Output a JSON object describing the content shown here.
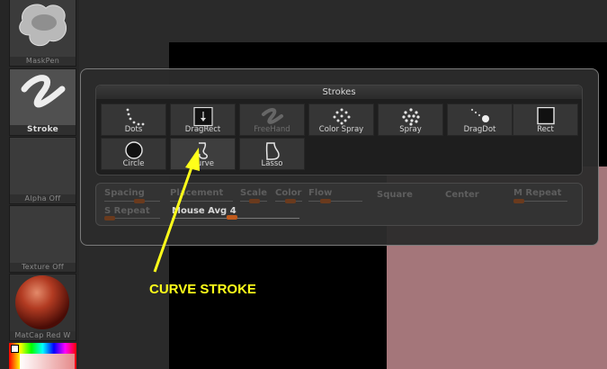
{
  "shelf": {
    "brush_label": "MaskPen",
    "stroke_label": "Stroke",
    "alpha_label": "Alpha Off",
    "texture_label": "Texture Off",
    "material_label": "MatCap Red W"
  },
  "strokes_panel": {
    "title": "Strokes",
    "items": [
      {
        "label": "Dots",
        "icon": "dots-icon"
      },
      {
        "label": "DragRect",
        "icon": "dragrect-icon"
      },
      {
        "label": "FreeHand",
        "icon": "freehand-icon"
      },
      {
        "label": "Color Spray",
        "icon": "color-spray-icon"
      },
      {
        "label": "Spray",
        "icon": "spray-icon"
      },
      {
        "label": "DragDot",
        "icon": "dragdot-icon"
      },
      {
        "label": "Rect",
        "icon": "rect-icon"
      },
      {
        "label": "Circle",
        "icon": "circle-icon"
      },
      {
        "label": "Curve",
        "icon": "curve-icon"
      },
      {
        "label": "Lasso",
        "icon": "lasso-icon"
      }
    ]
  },
  "stroke_settings": {
    "spacing": "Spacing",
    "placement": "Placement",
    "scale": "Scale",
    "color": "Color",
    "flow": "Flow",
    "square": "Square",
    "center": "Center",
    "m_repeat": "M Repeat",
    "s_repeat": "S Repeat",
    "mouse_avg": "Mouse Avg 4"
  },
  "annotation": {
    "text": "CURVE STROKE",
    "color": "#ffff1a"
  },
  "colors": {
    "slider_knob": "#c05a1c",
    "canvas_pink": "#a4767a"
  }
}
